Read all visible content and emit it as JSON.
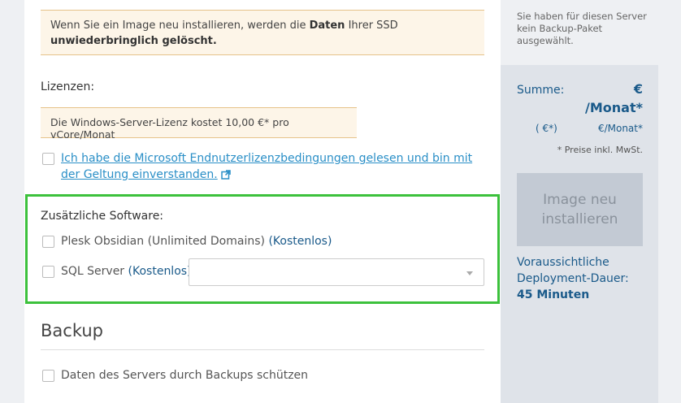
{
  "warning": {
    "part1": "Wenn Sie ein Image neu installieren, werden die ",
    "strong1": "Daten",
    "part2": " Ihrer SSD ",
    "strong2": "unwiederbringlich gelöscht."
  },
  "license": {
    "label": "Lizenzen:",
    "info": "Die Windows-Server-Lizenz kostet 10,00 €* pro vCore/Monat",
    "eula_text": "Ich habe die Microsoft Endnutzerlizenzbedingungen gelesen und bin mit der Geltung einverstanden."
  },
  "software": {
    "title": "Zusätzliche Software:",
    "options": [
      {
        "name": "Plesk Obsidian (Unlimited Domains)",
        "price": "(Kostenlos)"
      },
      {
        "name": "SQL Server",
        "price": "(Kostenlos)"
      }
    ],
    "sql_select_value": ""
  },
  "backup": {
    "title": "Backup",
    "option": "Daten des Servers durch Backups schützen"
  },
  "sidebar": {
    "note": "Sie haben für diesen Server kein Backup-Paket ausgewählt.",
    "sum_label": "Summe:",
    "sum_currency": "€",
    "sum_period": "/Monat*",
    "sub_left": "(   €*)",
    "sub_right": "€/Monat*",
    "vat": "* Preise inkl. MwSt.",
    "install_button": "Image neu installieren",
    "deploy_prefix": "Voraussichtliche Deployment-Dauer: ",
    "deploy_value": "45 Minuten"
  },
  "colors": {
    "accent": "#1a5a8a",
    "link": "#2a8fc7",
    "highlight": "#3cc13c",
    "warning_bg": "#fdf5e8"
  }
}
